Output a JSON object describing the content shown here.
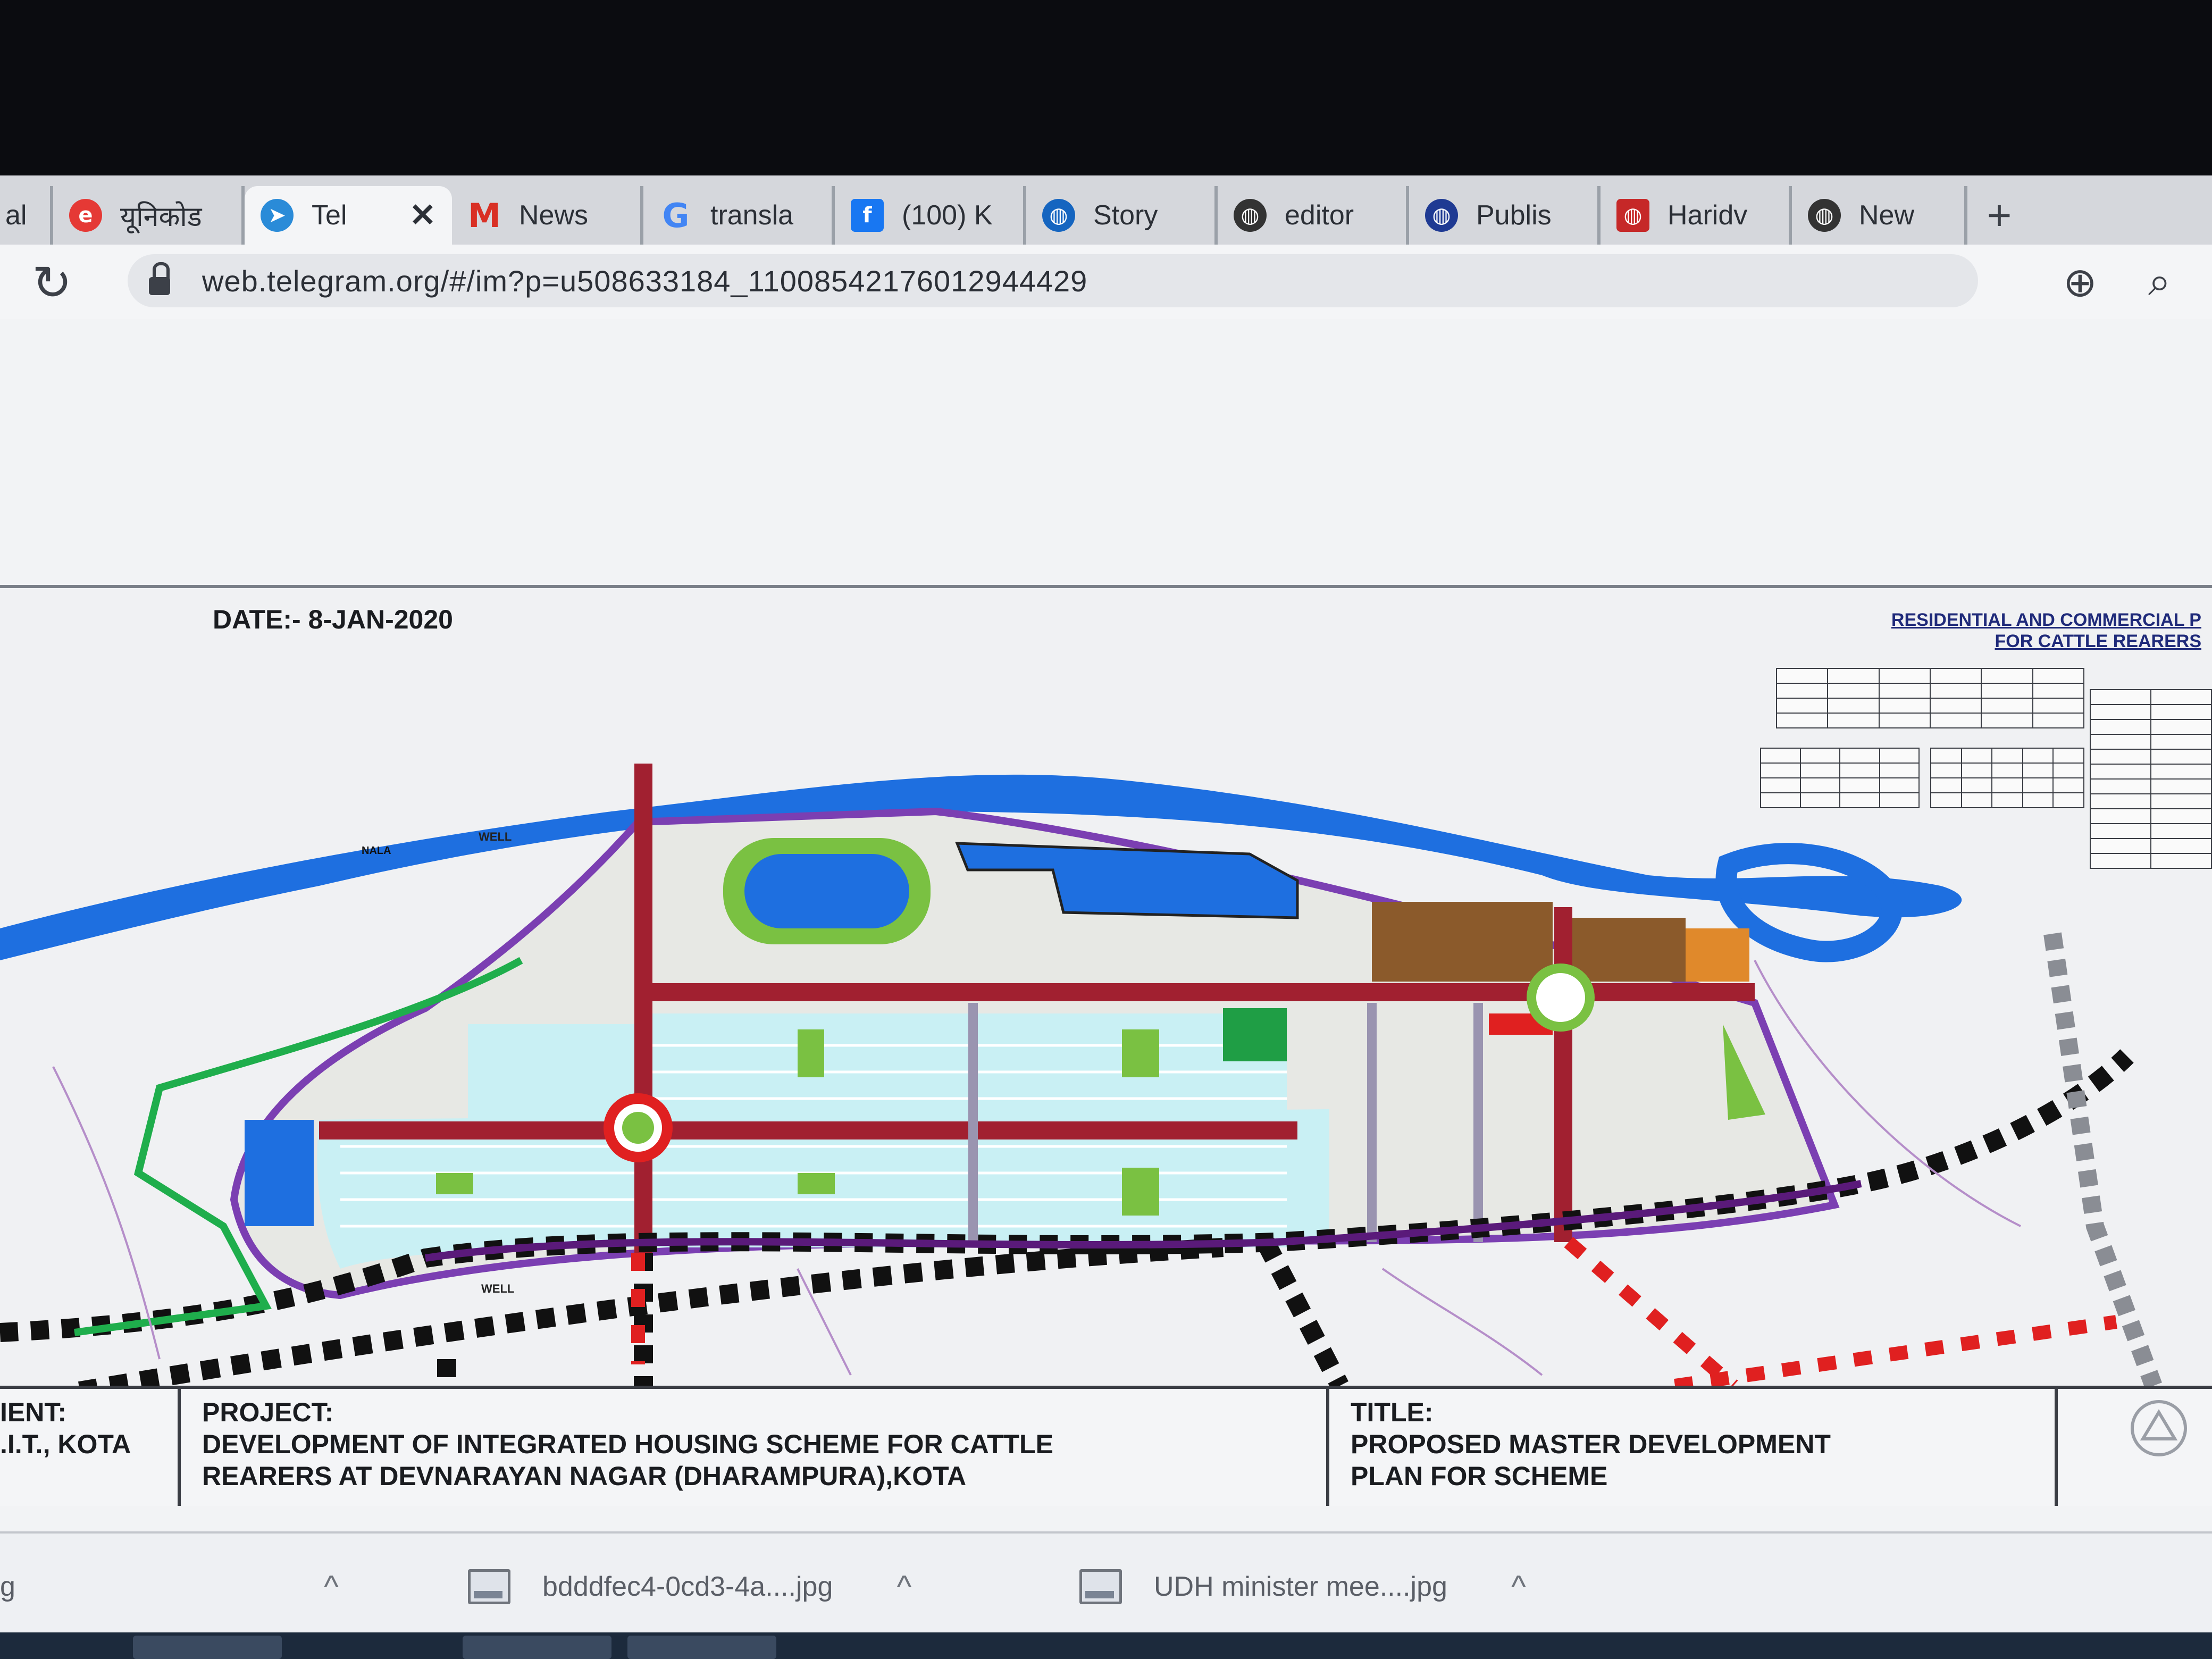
{
  "browser": {
    "tabs": [
      {
        "label": "al",
        "icon": "",
        "icon_color": "#d9d9d9"
      },
      {
        "label": "यूनिकोड",
        "icon": "e",
        "icon_color": "#e53935"
      },
      {
        "label": "Tel",
        "icon": "➤",
        "icon_color": "#2a8bd8",
        "active": true,
        "close": "✕"
      },
      {
        "label": "News",
        "icon": "M",
        "icon_color": "#d93025"
      },
      {
        "label": "transla",
        "icon": "G",
        "icon_color": "#4285f4"
      },
      {
        "label": "(100) K",
        "icon": "f",
        "icon_color": "#1877f2"
      },
      {
        "label": "Story",
        "icon": "◍",
        "icon_color": "#1565c0"
      },
      {
        "label": "editor",
        "icon": "◍",
        "icon_color": "#333333"
      },
      {
        "label": "Publis",
        "icon": "◍",
        "icon_color": "#1f3a93"
      },
      {
        "label": "Haridv",
        "icon": "◍",
        "icon_color": "#c62828"
      },
      {
        "label": "New",
        "icon": "◍",
        "icon_color": "#333333"
      }
    ],
    "new_tab": "+",
    "reload": "↻",
    "url": "web.telegram.org/#/im?p=u508633184_11008542176012944429",
    "icons": {
      "left": "⊕",
      "right": "⌕"
    }
  },
  "drawing": {
    "date": "DATE:- 8-JAN-2020",
    "title_line1": "RESIDENTIAL AND COMMERCIAL P",
    "title_line2": "FOR CATTLE REARERS",
    "map_labels": {
      "well_1": "WELL",
      "well_2": "WELL",
      "nala": "NALA"
    },
    "colors": {
      "water": "#1e6fe0",
      "residential": "#c9f0f4",
      "green": "#7ac142",
      "commercial": "#8b5a2b",
      "road": "#a12030",
      "boundary": "#7b3fb2"
    }
  },
  "title_block": {
    "client_label": "IENT:",
    "client_value": ".I.T., KOTA",
    "project_label": "PROJECT:",
    "project_line1": "DEVELOPMENT OF INTEGRATED HOUSING SCHEME FOR CATTLE",
    "project_line2": "REARERS AT DEVNARAYAN NAGAR (DHARAMPURA),KOTA",
    "title_label": "TITLE:",
    "title_line1": "PROPOSED MASTER DEVELOPMENT",
    "title_line2": "PLAN FOR SCHEME"
  },
  "downloads": {
    "items": [
      {
        "name": "g"
      },
      {
        "name": "bdddfec4-0cd3-4a....jpg"
      },
      {
        "name": "UDH minister mee....jpg"
      }
    ],
    "chevron": "^"
  }
}
